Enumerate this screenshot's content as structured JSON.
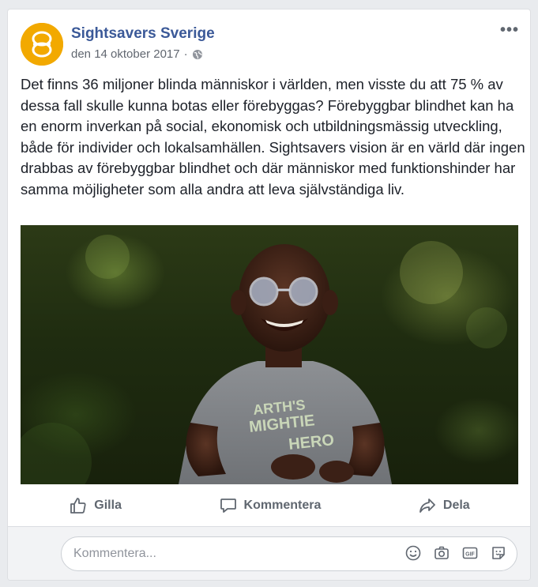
{
  "post": {
    "page_name": "Sightsavers Sverige",
    "date": "den 14 oktober 2017",
    "separator": "·",
    "privacy_icon": "globe-icon",
    "more_label": "•••",
    "text": "Det finns 36 miljoner blinda människor i världen, men visste du att 75 % av dessa fall skulle kunna botas eller förebyggas? Förebyggbar blindhet kan ha en enorm inverkan på social, ekonomisk och utbildningsmässig utveckling, både för individer och lokalsamhällen. Sightsavers vision är en värld där ingen drabbas av förebyggbar blindhet och där människor med funktionshinder har samma möjligheter som alla andra att leva självständiga liv.",
    "brand_color": "#f2a900",
    "link_color": "#3b5998"
  },
  "photo": {
    "shirt_text_line1": "ARTH'S",
    "shirt_text_line2": "MIGHTIE",
    "shirt_text_line3": "HERO"
  },
  "actions": {
    "like": {
      "label": "Gilla",
      "icon": "thumbs-up-icon"
    },
    "comment": {
      "label": "Kommentera",
      "icon": "speech-bubble-icon"
    },
    "share": {
      "label": "Dela",
      "icon": "share-arrow-icon"
    }
  },
  "comment_box": {
    "placeholder": "Kommentera...",
    "icons": [
      "smiley-icon",
      "camera-icon",
      "gif-icon",
      "sticker-icon"
    ],
    "gif_label": "GIF"
  }
}
